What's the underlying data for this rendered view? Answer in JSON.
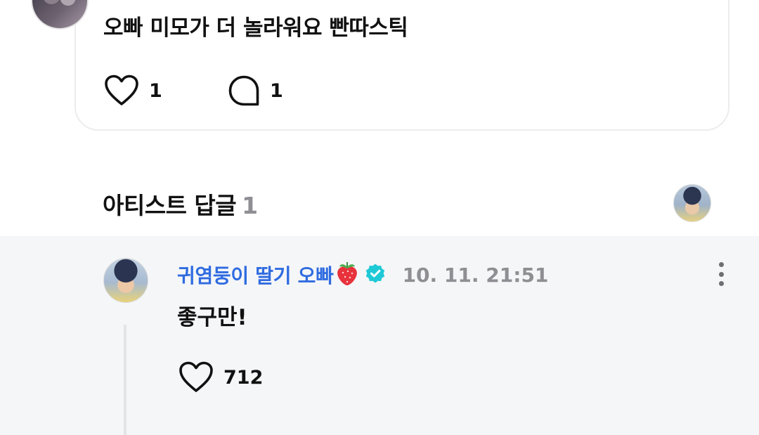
{
  "post": {
    "text": "오빠 미모가 더 놀라워요 빤따스틱",
    "like_count": "1",
    "comment_count": "1"
  },
  "section": {
    "title": "아티스트 답글",
    "count": "1"
  },
  "reply": {
    "author": "귀염둥이 딸기 오빠",
    "author_emoji": "strawberry-icon",
    "verified": true,
    "time": "10. 11. 21:51",
    "text": "좋구만!",
    "like_count": "712"
  },
  "colors": {
    "author_blue": "#2f6be0",
    "verified_teal": "#1ec9d6",
    "muted_gray": "#8e8e93",
    "reply_bg": "#f5f6f8"
  }
}
